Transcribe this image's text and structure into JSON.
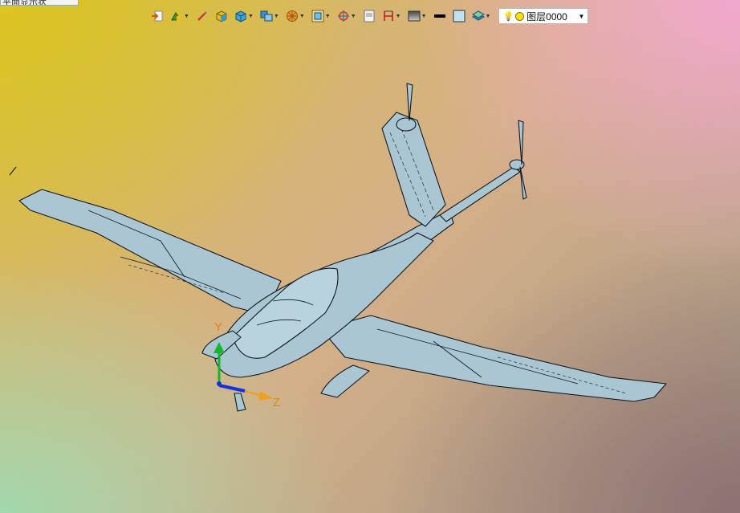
{
  "tab_stub": {
    "text": "平面显示状"
  },
  "toolbar": {
    "tools": [
      {
        "name": "import-export-icon",
        "caret": false
      },
      {
        "name": "render-mode-icon",
        "caret": true
      },
      {
        "name": "brush-icon",
        "caret": false
      },
      {
        "name": "shaded-box-icon",
        "caret": false
      },
      {
        "name": "view-cube-icon",
        "caret": true
      },
      {
        "name": "standard-views-icon",
        "caret": true
      },
      {
        "name": "section-view-icon",
        "caret": true
      },
      {
        "name": "zoom-window-icon",
        "caret": true
      },
      {
        "name": "rotate-view-icon",
        "caret": true
      },
      {
        "name": "frame-icon",
        "caret": false
      },
      {
        "name": "dimension-icon",
        "caret": true
      },
      {
        "name": "background-icon",
        "caret": true
      }
    ],
    "line_color": "#000000",
    "fill_color": "#bfe3f2",
    "layers_icon": "layers-icon",
    "layer_select": {
      "bulb": "💡",
      "label": "图层0000",
      "dot_color": "#ffe000"
    }
  },
  "triad": {
    "y_label": "Y",
    "z_label": "Z",
    "colors": {
      "y": "#12b82a",
      "z": "#f0a020",
      "x": "#1530e0"
    }
  },
  "model": {
    "fill": "#a9c6d2",
    "stroke": "#101820"
  }
}
